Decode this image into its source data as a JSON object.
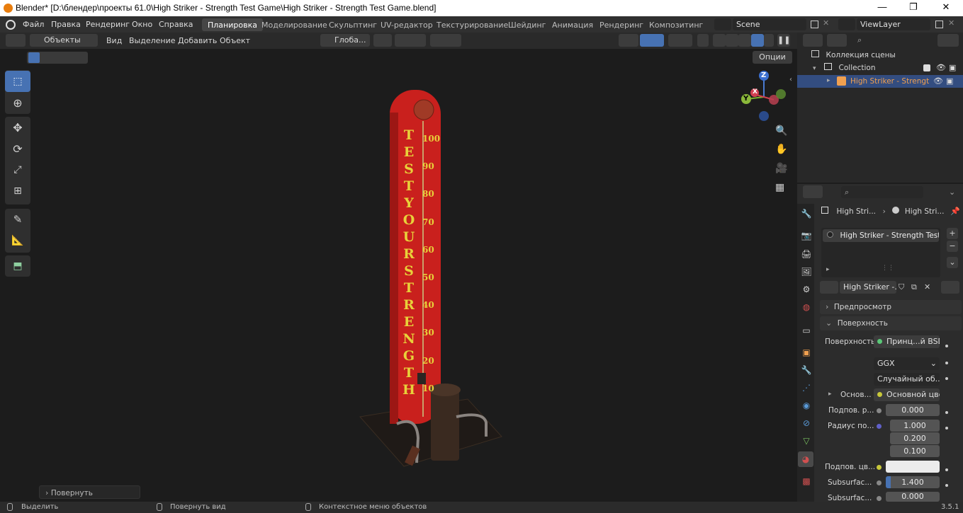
{
  "window": {
    "title": "Blender* [D:\\блендер\\проекты 61.0\\High Striker - Strength Test Game\\High Striker - Strength Test Game.blend]"
  },
  "menu": [
    "Файл",
    "Правка",
    "Рендеринг",
    "Окно",
    "Справка"
  ],
  "workspaces": [
    "Планировка",
    "Моделирование",
    "Скульптинг",
    "UV-редактор",
    "Текстурирование",
    "Шейдинг",
    "Анимация",
    "Рендеринг",
    "Композитинг"
  ],
  "scene": {
    "name": "Scene",
    "viewlayer": "ViewLayer"
  },
  "viewport_header": {
    "mode": "Объекты",
    "menus": [
      "Вид",
      "Выделение",
      "Добавить",
      "Объект"
    ],
    "transform": "Глоба...",
    "options": "Опции"
  },
  "viewport": {
    "model_text": "TEST YOUR STRENGTH",
    "scale": [
      "100",
      "90",
      "80",
      "70",
      "60",
      "50",
      "40",
      "30",
      "20",
      "10"
    ],
    "gizmo": {
      "x": "X",
      "y": "Y",
      "z": "Z"
    },
    "last_op": "Повернуть"
  },
  "outliner": {
    "root": "Коллекция сцены",
    "collection": "Collection",
    "object": "High Striker - Strengt"
  },
  "properties": {
    "breadcrumb_1": "High Stri...",
    "breadcrumb_2": "High Stri...",
    "slot": "High Striker - Strength Test...",
    "material_name": "High Striker -...",
    "preview_label": "Предпросмотр",
    "surface_panel": "Поверхность",
    "surface_label": "Поверхность",
    "surface_value": "Принц...й BSDF",
    "distribution": "GGX",
    "subsurface_method": "Случайный об...",
    "base_label": "Основ...",
    "base_value": "Основной цвет",
    "sub_weight_label": "Подпов. р...",
    "sub_weight": "0.000",
    "radius_label": "Радиус по...",
    "radius": [
      "1.000",
      "0.200",
      "0.100"
    ],
    "sub_color_label": "Подпов. цв...",
    "subsurf1_label": "Subsurfac...",
    "subsurf1": "1.400",
    "subsurf2_label": "Subsurfac...",
    "subsurf2": "0.000"
  },
  "status": {
    "select": "Выделить",
    "rotate": "Повернуть вид",
    "context": "Контекстное меню объектов",
    "version": "3.5.1"
  },
  "colors": {
    "accent": "#4772b3",
    "pole_red": "#d0231f",
    "text_yellow": "#e8d13a",
    "selected_orange": "#f0a050"
  }
}
